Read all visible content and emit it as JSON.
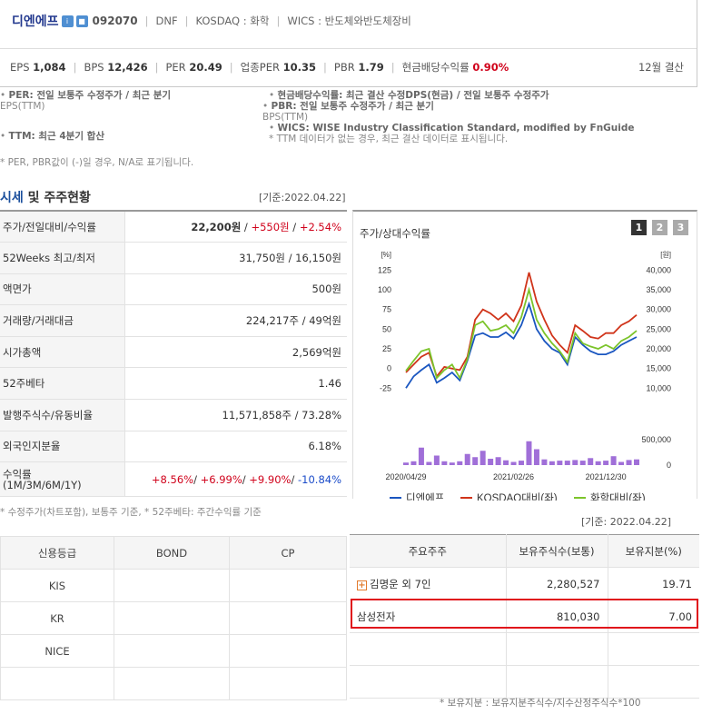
{
  "company": {
    "name": "디엔에프",
    "code": "092070",
    "tags": [
      "DNF",
      "KOSDAQ : 화학",
      "WICS : 반도체와반도체장비"
    ]
  },
  "metrics": {
    "eps_label": "EPS",
    "eps": "1,084",
    "bps_label": "BPS",
    "bps": "12,426",
    "per_label": "PER",
    "per": "20.49",
    "iper_label": "업종PER",
    "iper": "10.35",
    "pbr_label": "PBR",
    "pbr": "1.79",
    "div_label": "현금배당수익률",
    "div": "0.90%",
    "fiscal": "12월 결산"
  },
  "notes": {
    "per": "PER: 전일 보통주 수정주가 / 최근 분기",
    "per2": "EPS(TTM)",
    "ttm": "TTM: 최근 4분기 합산",
    "na": "* PER, PBR값이 (-)일 경우, N/A로 표기됩니다.",
    "div": "현금배당수익률: 최근 결산 수정DPS(현금) / 전일 보통주 수정주가",
    "pbr": "PBR: 전일 보통주 수정주가 / 최근 분기",
    "pbr2": "BPS(TTM)",
    "wics": "WICS: WISE Industry Classification Standard, modified by FnGuide",
    "ttm2": "* TTM 데이터가 없는 경우, 최근 결산 데이터로 표시됩니다."
  },
  "section": {
    "title_a": "시세",
    "title_b": " 및 주주현황",
    "date": "[기준:2022.04.22]"
  },
  "price_table": [
    {
      "k": "주가/전일대비/수익률",
      "price": "22,200원",
      "diff": "+550원",
      "rate": "+2.54%"
    },
    {
      "k": "52Weeks 최고/최저",
      "v": "31,750원 / 16,150원"
    },
    {
      "k": "액면가",
      "v": "500원"
    },
    {
      "k": "거래량/거래대금",
      "v": "224,217주 / 49억원"
    },
    {
      "k": "시가총액",
      "v": "2,569억원"
    },
    {
      "k": "52주베타",
      "v": "1.46"
    },
    {
      "k": "발행주식수/유동비율",
      "v": "11,571,858주 / 73.28%"
    },
    {
      "k": "외국인지분율",
      "v": "6.18%"
    },
    {
      "k": "수익률",
      "k2": "(1M/3M/6M/1Y)",
      "r1": "+8.56%",
      "r2": "+6.99%",
      "r3": "+9.90%",
      "r4": "-10.84%"
    }
  ],
  "price_note": "* 수정주가(차트포함), 보통주 기준, * 52주베타: 주간수익률 기준",
  "chart_title": "주가/상대수익률",
  "pages": [
    "1",
    "2",
    "3"
  ],
  "chart_data": {
    "type": "line",
    "x": [
      "2020/04/29",
      "",
      "",
      "",
      "",
      "",
      "",
      "",
      "",
      "",
      "",
      "",
      "",
      "",
      "2021/02/26",
      "",
      "",
      "",
      "",
      "",
      "",
      "",
      "",
      "",
      "",
      "",
      "2021/12/30",
      "",
      "",
      "",
      ""
    ],
    "x_ticks": [
      "2020/04/29",
      "2021/02/26",
      "2021/12/30"
    ],
    "y_left": {
      "unit": "[%]",
      "ticks": [
        "125",
        "100",
        "75",
        "50",
        "25",
        "0",
        "-25"
      ],
      "range": [
        -35,
        130
      ]
    },
    "y_right": {
      "unit": "[원]",
      "ticks": [
        "40,000",
        "35,000",
        "30,000",
        "25,000",
        "20,000",
        "15,000",
        "10,000"
      ],
      "vol_ticks": [
        "500,000",
        "0"
      ]
    },
    "series": [
      {
        "name": "디엔에프",
        "color": "#1a56c0",
        "values": [
          -25,
          -10,
          -2,
          5,
          -18,
          -12,
          -5,
          -15,
          10,
          42,
          45,
          40,
          40,
          46,
          38,
          55,
          82,
          50,
          35,
          25,
          20,
          5,
          40,
          30,
          22,
          18,
          18,
          22,
          30,
          35,
          40
        ]
      },
      {
        "name": "KOSDAQ대비(좌)",
        "color": "#d0341a",
        "values": [
          -5,
          5,
          15,
          20,
          -10,
          2,
          0,
          -2,
          15,
          62,
          75,
          70,
          62,
          70,
          60,
          80,
          122,
          85,
          62,
          42,
          30,
          20,
          55,
          48,
          40,
          38,
          45,
          45,
          55,
          60,
          68
        ]
      },
      {
        "name": "화학대비(좌)",
        "color": "#7cc42b",
        "values": [
          -3,
          10,
          22,
          25,
          -12,
          -2,
          5,
          -12,
          12,
          55,
          60,
          48,
          50,
          55,
          45,
          65,
          100,
          62,
          45,
          32,
          22,
          8,
          45,
          32,
          28,
          25,
          30,
          25,
          35,
          40,
          48
        ]
      }
    ],
    "volume": {
      "name": "거래량",
      "color": "#a06fd8",
      "values": [
        8,
        12,
        55,
        10,
        30,
        12,
        8,
        12,
        35,
        25,
        45,
        20,
        25,
        15,
        10,
        14,
        75,
        50,
        18,
        12,
        14,
        14,
        16,
        14,
        22,
        12,
        14,
        28,
        10,
        16,
        18
      ]
    }
  },
  "bond_table": {
    "headers": [
      "신용등급",
      "BOND",
      "CP"
    ],
    "rows": [
      [
        "KIS",
        "",
        ""
      ],
      [
        "KR",
        "",
        ""
      ],
      [
        "NICE",
        "",
        ""
      ],
      [
        "",
        "",
        ""
      ]
    ]
  },
  "holder_date": "[기준: 2022.04.22]",
  "holder_table": {
    "headers": [
      "주요주주",
      "보유주식수(보통)",
      "보유지분(%)"
    ],
    "rows": [
      {
        "name": "김명운 외 7인",
        "shares": "2,280,527",
        "pct": "19.71",
        "expand": true
      },
      {
        "name": "삼성전자",
        "shares": "810,030",
        "pct": "7.00"
      },
      {
        "name": "",
        "shares": "",
        "pct": ""
      },
      {
        "name": "",
        "shares": "",
        "pct": ""
      }
    ]
  },
  "holder_note": "* 보유지분 : 보유지분주식수/지수산정주식수*100"
}
